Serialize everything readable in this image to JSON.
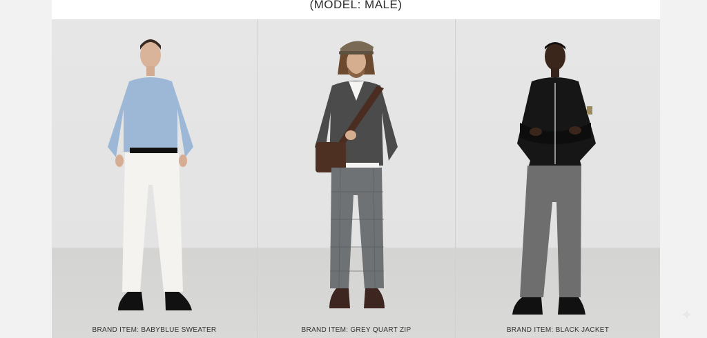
{
  "header": {
    "title": "(MODEL: MALE)"
  },
  "looks": [
    {
      "caption": "BRAND ITEM: BABYBLUE SWEATER",
      "top_color": "#9db8d6",
      "bottom_color": "#f4f3ef",
      "shoe_color": "#111111"
    },
    {
      "caption": "BRAND ITEM: GREY QUART ZIP",
      "top_color": "#4a4b4a",
      "bottom_color": "#6f7274",
      "shoe_color": "#3d2520",
      "accessory": "brown-crossbody-bag",
      "hat_color": "#7a6a55"
    },
    {
      "caption": "BRAND ITEM: BLACK JACKET",
      "top_color": "#161616",
      "bottom_color": "#6e6e6e",
      "shoe_color": "#111111"
    }
  ]
}
